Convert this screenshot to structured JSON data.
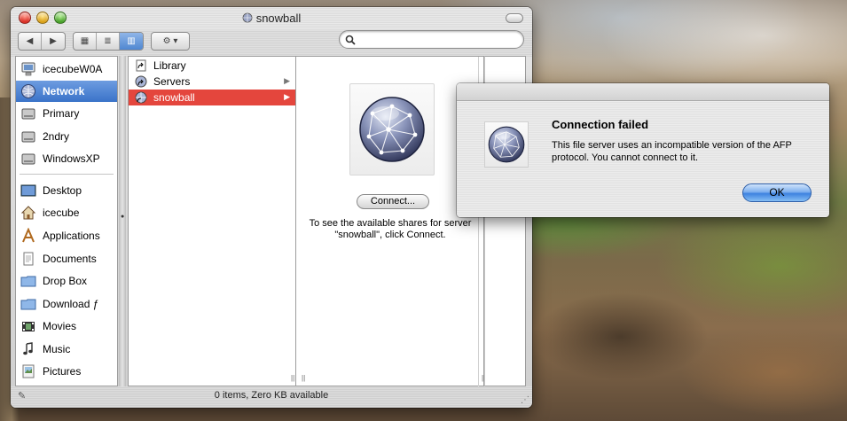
{
  "window": {
    "title": "snowball"
  },
  "toolbar": {
    "back_symbol": "◀",
    "forward_symbol": "▶",
    "view_icon_symbol": "▦",
    "view_list_symbol": "≣",
    "view_column_symbol": "▥",
    "action_symbol": "⚙ ▾"
  },
  "search": {
    "value": "",
    "placeholder": ""
  },
  "sidebar": {
    "devices": [
      {
        "label": "icecubeW0A",
        "icon": "computer-icon",
        "selected": false
      },
      {
        "label": "Network",
        "icon": "network-globe-icon",
        "selected": true
      },
      {
        "label": "Primary",
        "icon": "hard-disk-icon",
        "selected": false
      },
      {
        "label": "2ndry",
        "icon": "hard-disk-icon",
        "selected": false
      },
      {
        "label": "WindowsXP",
        "icon": "hard-disk-icon",
        "selected": false
      }
    ],
    "places": [
      {
        "label": "Desktop",
        "icon": "desktop-icon"
      },
      {
        "label": "icecube",
        "icon": "home-icon"
      },
      {
        "label": "Applications",
        "icon": "applications-icon"
      },
      {
        "label": "Documents",
        "icon": "documents-icon"
      },
      {
        "label": "Drop Box",
        "icon": "folder-icon"
      },
      {
        "label": "Download ƒ",
        "icon": "folder-icon"
      },
      {
        "label": "Movies",
        "icon": "movies-icon"
      },
      {
        "label": "Music",
        "icon": "music-icon"
      },
      {
        "label": "Pictures",
        "icon": "pictures-icon"
      }
    ]
  },
  "column": {
    "items": [
      {
        "label": "Library",
        "icon": "alias-icon",
        "has_children": false,
        "selected": false
      },
      {
        "label": "Servers",
        "icon": "alias-icon",
        "has_children": true,
        "selected": false
      },
      {
        "label": "snowball",
        "icon": "server-icon",
        "has_children": true,
        "selected": true
      }
    ]
  },
  "preview": {
    "connect_label": "Connect...",
    "info_text": "To see the available shares for server \"snowball\", click Connect."
  },
  "status": {
    "text": "0 items, Zero KB available"
  },
  "alert": {
    "title": "Connection failed",
    "message": "This file server uses an incompatible version of the AFP protocol. You cannot connect to it.",
    "ok_label": "OK"
  },
  "colors": {
    "selection_blue": "#3a73c9",
    "selection_red": "#e4463d",
    "ok_button": "#3d82e0"
  }
}
